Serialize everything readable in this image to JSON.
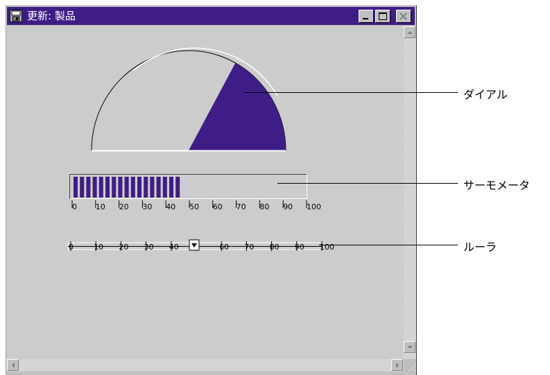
{
  "window": {
    "title": "更新: 製品",
    "title_bg": "#3f1d86"
  },
  "dial": {
    "value_percent": 66,
    "fill_color": "#3f1d86"
  },
  "thermometer": {
    "value": 48,
    "max": 100,
    "tick_labels": [
      "0",
      "10",
      "20",
      "30",
      "40",
      "50",
      "60",
      "70",
      "80",
      "90",
      "100"
    ]
  },
  "ruler": {
    "value": 50,
    "max": 100,
    "tick_labels": [
      "0",
      "10",
      "20",
      "30",
      "40",
      "50",
      "60",
      "70",
      "80",
      "90",
      "100"
    ]
  },
  "callouts": {
    "dial": "ダイアル",
    "thermometer": "サーモメータ",
    "ruler": "ルーラ"
  },
  "icons": {
    "window_icon": "window-save-icon",
    "minimize": "minimize-icon",
    "maximize": "maximize-icon",
    "close": "close-icon"
  }
}
